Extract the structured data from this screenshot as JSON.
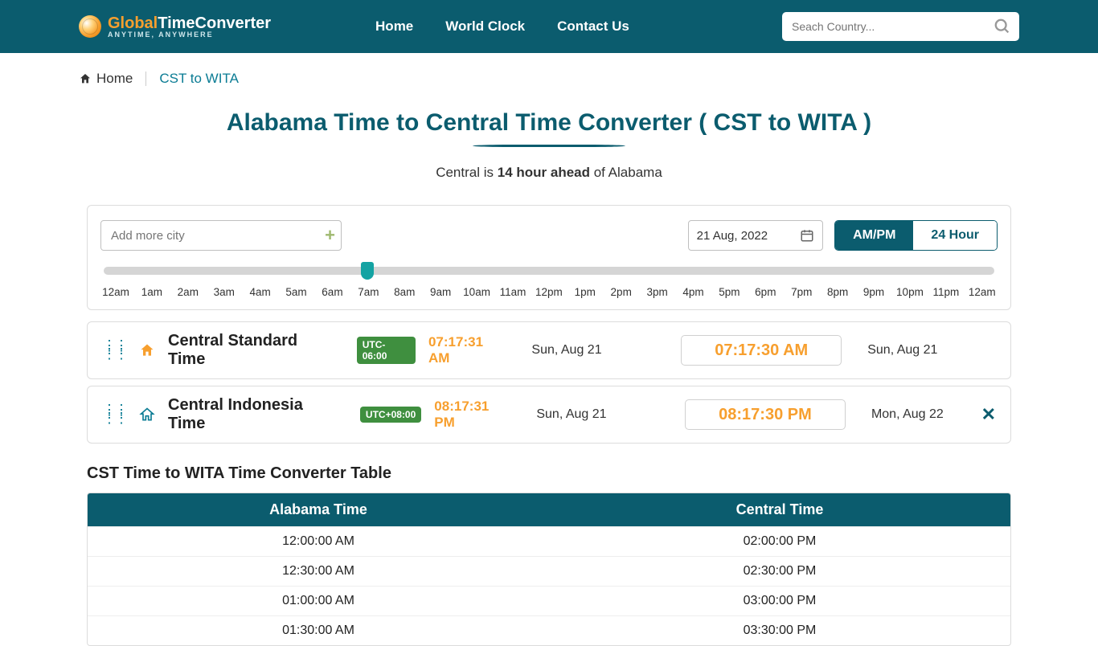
{
  "brand": {
    "name1": "Global",
    "name2": "TimeConverter",
    "tagline": "ANYTIME, ANYWHERE"
  },
  "nav": {
    "home": "Home",
    "worldclock": "World Clock",
    "contact": "Contact Us"
  },
  "search": {
    "placeholder": "Seach Country..."
  },
  "breadcrumb": {
    "home": "Home",
    "current": "CST to WITA"
  },
  "page": {
    "title": "Alabama Time to Central Time Converter ( CST to WITA )",
    "sub_pre": "Central is ",
    "sub_bold": "14 hour ahead",
    "sub_post": " of Alabama"
  },
  "controls": {
    "add_city_placeholder": "Add more city",
    "date": "21 Aug, 2022",
    "ampm": "AM/PM",
    "h24": "24 Hour"
  },
  "slider": {
    "ticks": [
      "12am",
      "1am",
      "2am",
      "3am",
      "4am",
      "5am",
      "6am",
      "7am",
      "8am",
      "9am",
      "10am",
      "11am",
      "12pm",
      "1pm",
      "2pm",
      "3pm",
      "4pm",
      "5pm",
      "6pm",
      "7pm",
      "8pm",
      "9pm",
      "10pm",
      "11pm",
      "12am"
    ],
    "pos_percent": 29.6
  },
  "zones": [
    {
      "name": "Central Standard Time",
      "utc": "UTC-06:00",
      "live": "07:17:31 AM",
      "live_date": "Sun, Aug 21",
      "input": "07:17:30 AM",
      "input_date": "Sun, Aug 21",
      "is_home": true,
      "closable": false
    },
    {
      "name": "Central Indonesia Time",
      "utc": "UTC+08:00",
      "live": "08:17:31 PM",
      "live_date": "Sun, Aug 21",
      "input": "08:17:30 PM",
      "input_date": "Mon, Aug 22",
      "is_home": false,
      "closable": true
    }
  ],
  "table": {
    "title": "CST Time to WITA Time Converter Table",
    "head": [
      "Alabama Time",
      "Central Time"
    ],
    "rows": [
      [
        "12:00:00 AM",
        "02:00:00 PM"
      ],
      [
        "12:30:00 AM",
        "02:30:00 PM"
      ],
      [
        "01:00:00 AM",
        "03:00:00 PM"
      ],
      [
        "01:30:00 AM",
        "03:30:00 PM"
      ]
    ]
  }
}
